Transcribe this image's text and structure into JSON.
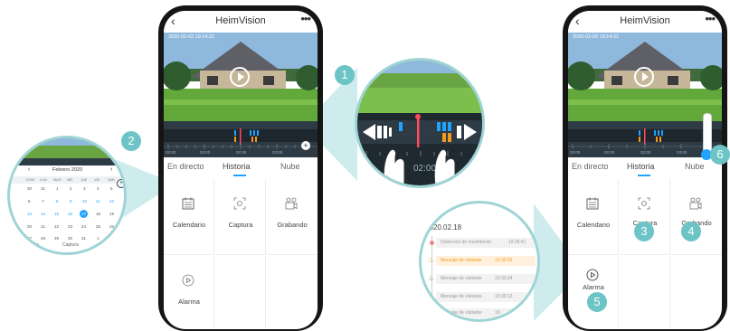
{
  "colors": {
    "accent": "#1fa3ff",
    "badge": "#6cc4c6",
    "phone_frame": "#151515",
    "timeline_bg": "#2e3a44",
    "alert_orange": "#f39a1e",
    "marker_red": "#ff4a5a"
  },
  "left_phone": {
    "header": {
      "back_icon": "chevron-left-icon",
      "title": "HeimVision",
      "more_icon": "more-icon"
    },
    "video": {
      "timestamp": "2020-02-02   19:14:22",
      "play_icon": "play-icon"
    },
    "timeline": {
      "ticks": [
        "03:00",
        "03:00",
        "02:00",
        "03:00"
      ],
      "zoom_icon": "plus-icon"
    },
    "tabs": [
      {
        "label": "En directo"
      },
      {
        "label": "Historia",
        "active": true
      },
      {
        "label": "Nube"
      }
    ],
    "grid": [
      {
        "label": "Calendario",
        "icon": "calendar-icon"
      },
      {
        "label": "Captura",
        "icon": "capture-icon"
      },
      {
        "label": "Grabando",
        "icon": "recording-icon"
      },
      {
        "label": "Alarma",
        "icon": "alarm-icon"
      }
    ]
  },
  "right_phone": {
    "header": {
      "title": "HeimVision"
    },
    "video": {
      "timestamp": "2020-02-02   19:14:22"
    },
    "timeline": {
      "ticks": [
        "03:00",
        "02:00",
        "02:00",
        "03:00"
      ]
    },
    "tabs": [
      {
        "label": "En directo"
      },
      {
        "label": "Historia",
        "active": true
      },
      {
        "label": "Nube"
      }
    ],
    "grid": [
      {
        "label": "Calendario",
        "icon": "calendar-icon"
      },
      {
        "label": "Captura",
        "icon": "capture-icon"
      },
      {
        "label": "Grabando",
        "icon": "recording-icon"
      },
      {
        "label": "Alarma",
        "icon": "alarm-icon"
      }
    ]
  },
  "calendar": {
    "month": "Febrero 2020",
    "weekdays": [
      "DOM",
      "LUN",
      "MAR",
      "MIE",
      "JUE",
      "VIE",
      "SAB"
    ],
    "weeks": [
      [
        "30",
        "31",
        "1",
        "2",
        "3",
        "4",
        "5"
      ],
      [
        "6",
        "7",
        "8",
        "9",
        "10",
        "11",
        "12"
      ],
      [
        "13",
        "14",
        "15",
        "16",
        "17",
        "18",
        "19"
      ],
      [
        "20",
        "21",
        "22",
        "23",
        "24",
        "25",
        "26"
      ],
      [
        "27",
        "28",
        "29",
        "30",
        "31",
        "1",
        "2"
      ]
    ],
    "selected": "17",
    "footer": [
      "ndario",
      "Captura",
      "Gra"
    ]
  },
  "timeline_zoom": {
    "time": "02:00"
  },
  "alarm_list": {
    "date": "2020.02.18",
    "items": [
      {
        "text": "Detección de movimiento",
        "time": "19:26:41",
        "highlight": false
      },
      {
        "text": "Mensaje de visitante",
        "time": "19:32:29",
        "highlight": true
      },
      {
        "text": "Mensaje de visitante",
        "time": "19:33:34",
        "highlight": false
      },
      {
        "text": "Mensaje de visitante",
        "time": "19:35:12",
        "highlight": false
      },
      {
        "text": "Mensaje de visitante",
        "time": "19:",
        "highlight": false
      }
    ]
  },
  "callouts": [
    "1",
    "2",
    "3",
    "4",
    "5",
    "6"
  ]
}
